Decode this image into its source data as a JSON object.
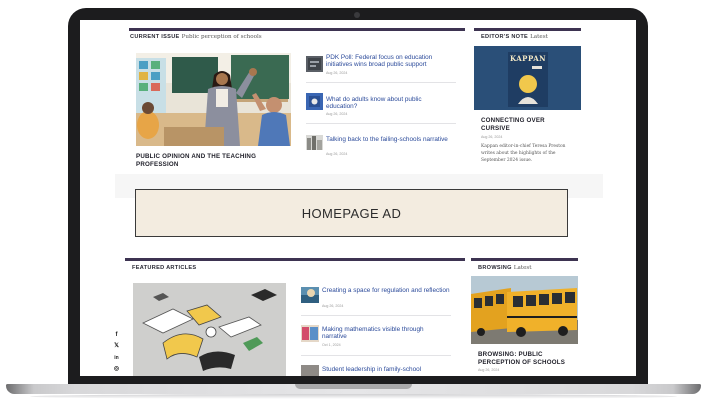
{
  "homepage": {
    "current_issue": {
      "heading": "CURRENT ISSUE",
      "subheading": "Public perception of schools",
      "feature_caption": "PUBLIC OPINION AND THE TEACHING PROFESSION",
      "articles": [
        {
          "title": "PDK Poll: Federal focus on education initiatives wins broad public support",
          "date": "Aug 26, 2024"
        },
        {
          "title": "What do adults know about public education?",
          "date": "Aug 26, 2024"
        },
        {
          "title": "Talking back to the failing-schools narrative",
          "date": "Aug 26, 2024"
        }
      ]
    },
    "editors_note": {
      "heading": "EDITOR'S NOTE",
      "subheading": "Latest",
      "cover_title": "KAPPAN",
      "article_title": "CONNECTING OVER CURSIVE",
      "date": "Aug 26, 2024",
      "excerpt": "Kappan editor-in-chief Teresa Preston writes about the highlights of the September 2024 issue."
    },
    "ad": {
      "label": "HOMEPAGE AD"
    },
    "featured": {
      "heading": "FEATURED ARTICLES",
      "articles": [
        {
          "title": "Creating a space for regulation and reflection",
          "date": "Aug 26, 2024"
        },
        {
          "title": "Making mathematics visible through narrative",
          "date": "Oct 1, 2024"
        },
        {
          "title": "Student leadership in family-school",
          "date": ""
        }
      ]
    },
    "browsing": {
      "heading": "BROWSING",
      "subheading": "Latest",
      "article_title": "BROWSING: PUBLIC PERCEPTION OF SCHOOLS",
      "date": "Aug 26, 2024"
    },
    "social": {
      "icons": [
        "facebook-icon",
        "x-icon",
        "linkedin-icon",
        "instagram-icon"
      ],
      "glyphs": [
        "f",
        "𝕏",
        "in",
        "◎"
      ]
    }
  },
  "colors": {
    "section_rule": "#3d3351",
    "link": "#2b4a9a",
    "ad_background": "#f3ece0",
    "kappan_cover": "#2a4f78"
  }
}
